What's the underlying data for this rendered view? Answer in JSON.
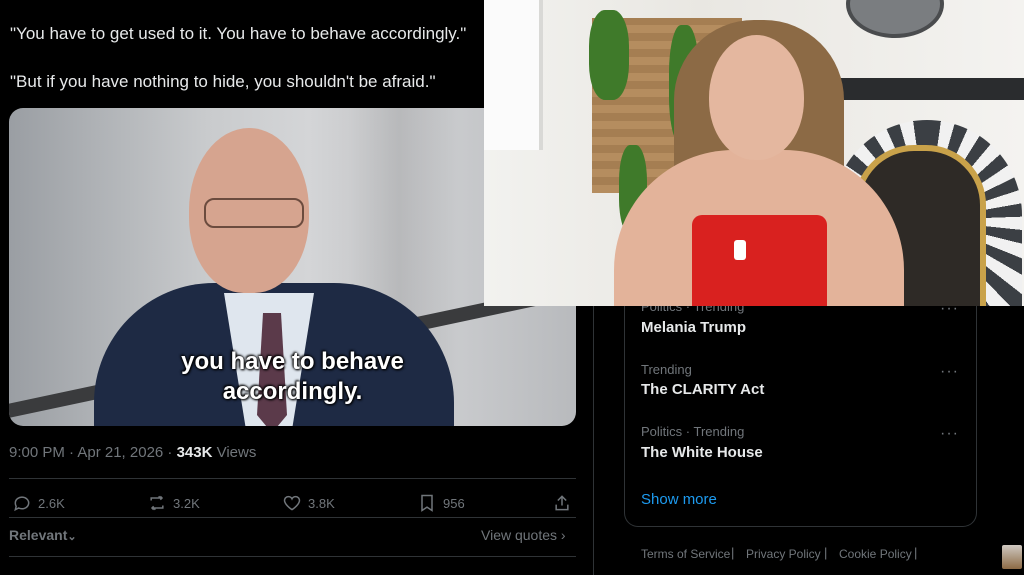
{
  "tweet": {
    "quote_1": "\"You have to get used to it. You have to behave accordingly.\"",
    "quote_2": "\"But if you have nothing to hide, you shouldn't be afraid.\"",
    "video_subtitle_line1": "you have to behave",
    "video_subtitle_line2": "accordingly.",
    "timestamp": "9:00 PM · Apr 21, 2026 · ",
    "views_count": "343K",
    "views_label": " Views",
    "actions": {
      "replies": "2.6K",
      "reposts": "3.2K",
      "likes": "3.8K",
      "bookmarks": "956"
    },
    "sort_label": "Relevant",
    "view_quotes_label": "View quotes ›"
  },
  "trends": {
    "items": [
      {
        "category": "Politics · Trending",
        "name": "Melania Trump"
      },
      {
        "category": "Trending",
        "name": "The CLARITY Act"
      },
      {
        "category": "Politics · Trending",
        "name": "The White House"
      }
    ],
    "more_icon": "···",
    "show_more": "Show more"
  },
  "footer": {
    "links": [
      "Terms of Service",
      "Privacy Policy",
      "Cookie Policy"
    ],
    "separator": "|"
  },
  "colors": {
    "accent": "#1d9bf0",
    "muted": "#71767b",
    "text": "#e7e9ea",
    "border": "#2f3336"
  },
  "icons": [
    "reply-icon",
    "repost-icon",
    "like-icon",
    "bookmark-icon",
    "share-icon",
    "chevron-down-icon",
    "more-icon"
  ]
}
